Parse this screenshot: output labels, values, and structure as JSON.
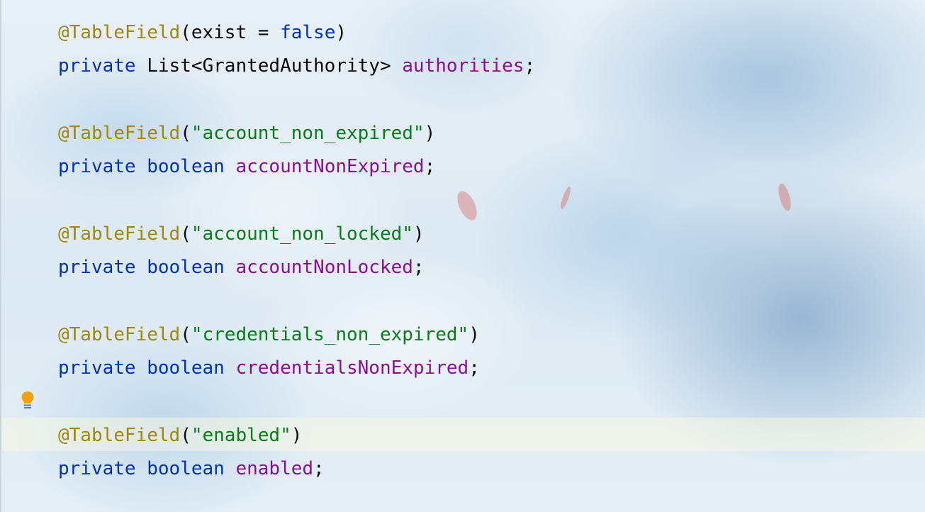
{
  "editor": {
    "lines": [
      [
        {
          "t": "@TableField",
          "k": "annotation"
        },
        {
          "t": "(exist = ",
          "k": "plain"
        },
        {
          "t": "false",
          "k": "keyword"
        },
        {
          "t": ")",
          "k": "plain"
        }
      ],
      [
        {
          "t": "private",
          "k": "keyword"
        },
        {
          "t": " List<GrantedAuthority> ",
          "k": "plain"
        },
        {
          "t": "authorities",
          "k": "field"
        },
        {
          "t": ";",
          "k": "plain"
        }
      ],
      [],
      [
        {
          "t": "@TableField",
          "k": "annotation"
        },
        {
          "t": "(",
          "k": "plain"
        },
        {
          "t": "\"account_non_expired\"",
          "k": "string"
        },
        {
          "t": ")",
          "k": "plain"
        }
      ],
      [
        {
          "t": "private",
          "k": "keyword"
        },
        {
          "t": " ",
          "k": "plain"
        },
        {
          "t": "boolean",
          "k": "keyword"
        },
        {
          "t": " ",
          "k": "plain"
        },
        {
          "t": "accountNonExpired",
          "k": "field"
        },
        {
          "t": ";",
          "k": "plain"
        }
      ],
      [],
      [
        {
          "t": "@TableField",
          "k": "annotation"
        },
        {
          "t": "(",
          "k": "plain"
        },
        {
          "t": "\"account_non_locked\"",
          "k": "string"
        },
        {
          "t": ")",
          "k": "plain"
        }
      ],
      [
        {
          "t": "private",
          "k": "keyword"
        },
        {
          "t": " ",
          "k": "plain"
        },
        {
          "t": "boolean",
          "k": "keyword"
        },
        {
          "t": " ",
          "k": "plain"
        },
        {
          "t": "accountNonLocked",
          "k": "field"
        },
        {
          "t": ";",
          "k": "plain"
        }
      ],
      [],
      [
        {
          "t": "@TableField",
          "k": "annotation"
        },
        {
          "t": "(",
          "k": "plain"
        },
        {
          "t": "\"credentials_non_expired\"",
          "k": "string"
        },
        {
          "t": ")",
          "k": "plain"
        }
      ],
      [
        {
          "t": "private",
          "k": "keyword"
        },
        {
          "t": " ",
          "k": "plain"
        },
        {
          "t": "boolean",
          "k": "keyword"
        },
        {
          "t": " ",
          "k": "plain"
        },
        {
          "t": "credentialsNonExpired",
          "k": "field"
        },
        {
          "t": ";",
          "k": "plain"
        }
      ],
      [],
      [
        {
          "t": "@TableField",
          "k": "annotation"
        },
        {
          "t": "(",
          "k": "plain"
        },
        {
          "t": "\"enabled\"",
          "k": "string"
        },
        {
          "t": ")",
          "k": "plain"
        }
      ],
      [
        {
          "t": "private",
          "k": "keyword"
        },
        {
          "t": " ",
          "k": "plain"
        },
        {
          "t": "boolean",
          "k": "keyword"
        },
        {
          "t": " ",
          "k": "plain"
        },
        {
          "t": "enabled",
          "k": "field"
        },
        {
          "t": ";",
          "k": "plain"
        }
      ]
    ],
    "current_line_index": 12
  },
  "gutter": {
    "intention_icon": "lightbulb-icon"
  },
  "colors": {
    "annotation": "#9e880d",
    "keyword": "#0033b3",
    "string": "#067d17",
    "field": "#871094",
    "plain": "#080808",
    "bulb": "#f0a30a"
  }
}
